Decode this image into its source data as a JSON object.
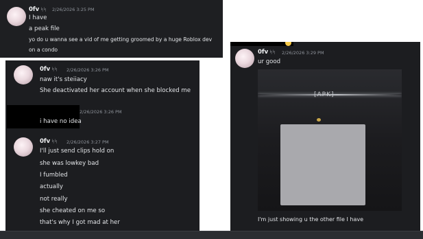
{
  "user": {
    "name": "0fv",
    "glyph": "ᛋᛋ"
  },
  "panel1": {
    "timestamp": "2/26/2026 3:25 PM",
    "lines": [
      "I have",
      "a peak file",
      "yo do u wanna see a vid of me getting groomed by a huge Roblox dev",
      "on a condo"
    ]
  },
  "panel2": {
    "group1": {
      "timestamp": "2/26/2026 3:26 PM",
      "lines": [
        "naw it's steiiacy",
        "She deactivated her account when she blocked me"
      ]
    },
    "group2": {
      "timestamp": "2/26/2026 3:26 PM",
      "lines": [
        "i have no idea"
      ]
    },
    "group3": {
      "timestamp": "2/26/2026 3:27 PM",
      "lines": [
        "I'll just send clips hold on",
        "she was lowkey bad",
        "I fumbled",
        "actually",
        "not really",
        "she cheated on me so",
        "that's why I got mad at her"
      ]
    }
  },
  "panel3": {
    "timestamp": "2/26/2026 3:29 PM",
    "lines": [
      "ur good"
    ],
    "video_logo": "[APK]",
    "caption": "I'm just showing u the other file I have"
  }
}
